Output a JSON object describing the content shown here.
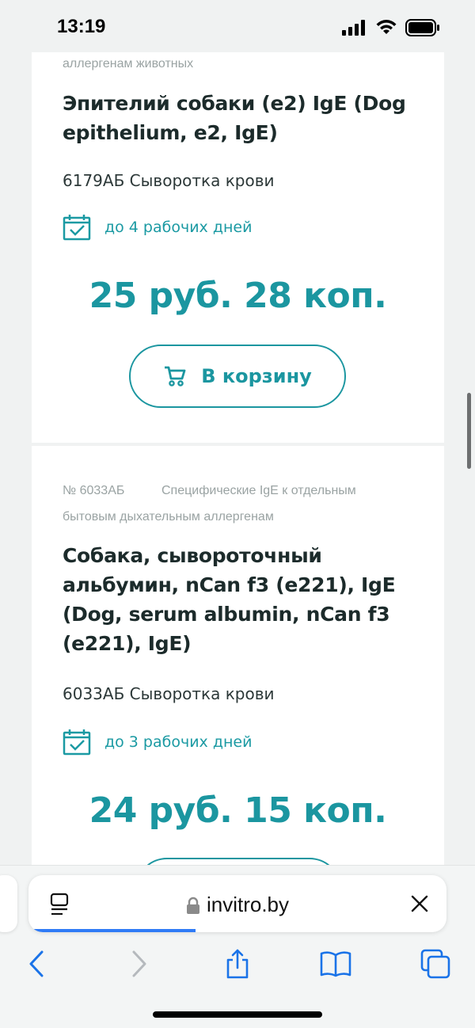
{
  "status_bar": {
    "time": "13:19"
  },
  "cards": [
    {
      "category_tail": "аллергенам животных",
      "title": "Эпителий собаки (e2) IgE (Dog epithelium, e2, IgE)",
      "sample": "6179АБ Сыворотка крови",
      "delivery": "до 4 рабочих дней",
      "price": "25 руб. 28 коп.",
      "cart_label": "В корзину"
    },
    {
      "number": "№ 6033АБ",
      "category_line1": "Специфические IgE к отдельным",
      "category_line2": "бытовым дыхательным аллергенам",
      "title": "Собака, сывороточный альбумин, nCan f3 (e221), IgE (Dog, serum albumin, nCan f3 (e221), IgE)",
      "sample": "6033АБ Сыворотка крови",
      "delivery": "до 3 рабочих дней",
      "price": "24 руб. 15 коп."
    }
  ],
  "browser": {
    "url": "invitro.by",
    "load_progress_percent": 40
  },
  "colors": {
    "accent": "#1b96a0",
    "progress": "#2f7bf6",
    "ios_blue": "#1a73e8"
  }
}
